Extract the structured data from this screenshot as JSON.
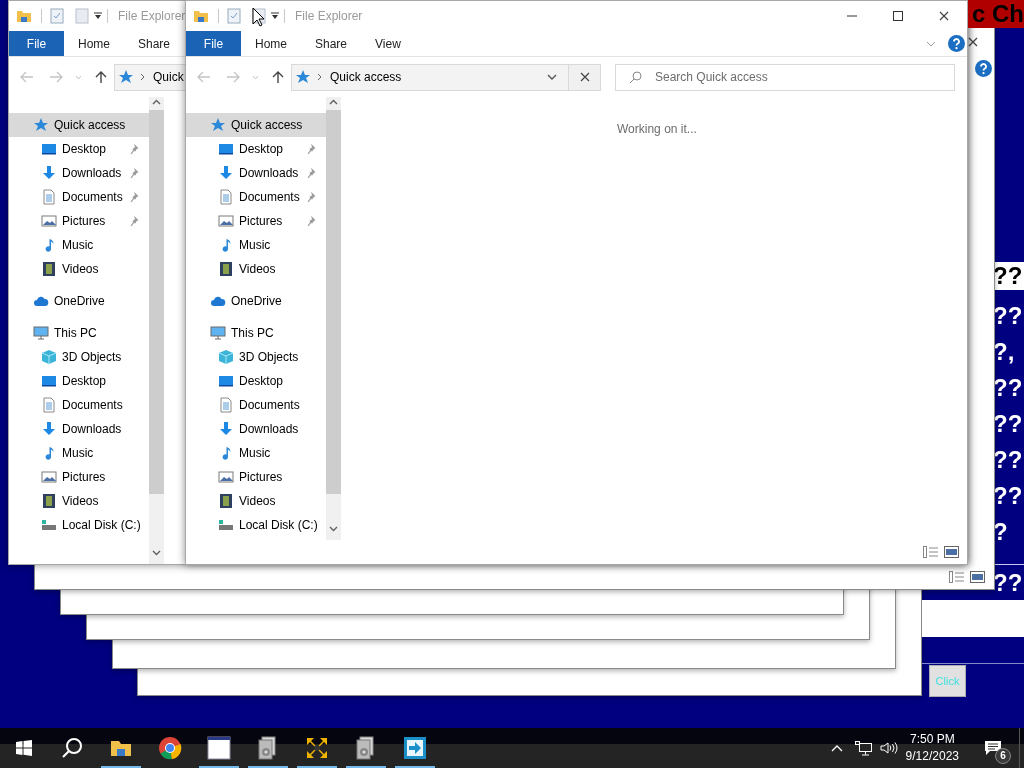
{
  "desktop_app": {
    "banner": "c Ch",
    "lines": [
      {
        "text": "??",
        "kind": "boxed"
      },
      {
        "text": "??",
        "kind": "plain"
      },
      {
        "text": "?,",
        "kind": "plain"
      },
      {
        "text": "??",
        "kind": "plain"
      },
      {
        "text": "??",
        "kind": "plain"
      },
      {
        "text": "??",
        "kind": "plain"
      },
      {
        "text": "??",
        "kind": "plain"
      },
      {
        "text": "?",
        "kind": "plain"
      },
      {
        "text": "??",
        "kind": "split"
      }
    ],
    "click_button": "Click"
  },
  "back_window": {
    "title": "File Explorer",
    "ribbon_tabs": [
      {
        "label": "File",
        "kind": "file"
      },
      {
        "label": "Home",
        "kind": "tab"
      },
      {
        "label": "Share",
        "kind": "tab"
      }
    ],
    "address": "Quick",
    "nav": [
      {
        "label": "Quick access",
        "kind": "star",
        "pinned": false,
        "selected": true,
        "children": [
          {
            "label": "Desktop",
            "kind": "desktop",
            "pinned": true,
            "selected": false
          },
          {
            "label": "Downloads",
            "kind": "downloads",
            "pinned": true,
            "selected": false
          },
          {
            "label": "Documents",
            "kind": "documents",
            "pinned": true,
            "selected": false
          },
          {
            "label": "Pictures",
            "kind": "pictures",
            "pinned": true,
            "selected": false
          },
          {
            "label": "Music",
            "kind": "music",
            "pinned": false,
            "selected": false
          },
          {
            "label": "Videos",
            "kind": "videos",
            "pinned": false,
            "selected": false
          }
        ]
      },
      {
        "label": "OneDrive",
        "kind": "cloud",
        "pinned": false,
        "selected": false
      },
      {
        "label": "This PC",
        "kind": "pc",
        "pinned": false,
        "selected": false,
        "children": [
          {
            "label": "3D Objects",
            "kind": "cube",
            "pinned": false,
            "selected": false
          },
          {
            "label": "Desktop",
            "kind": "desktop",
            "pinned": false,
            "selected": false
          },
          {
            "label": "Documents",
            "kind": "documents",
            "pinned": false,
            "selected": false
          },
          {
            "label": "Downloads",
            "kind": "downloads",
            "pinned": false,
            "selected": false
          },
          {
            "label": "Music",
            "kind": "music",
            "pinned": false,
            "selected": false
          },
          {
            "label": "Pictures",
            "kind": "pictures",
            "pinned": false,
            "selected": false
          },
          {
            "label": "Videos",
            "kind": "videos",
            "pinned": false,
            "selected": false
          },
          {
            "label": "Local Disk (C:)",
            "kind": "disk",
            "pinned": false,
            "selected": false
          }
        ]
      }
    ]
  },
  "front_window": {
    "title": "File Explorer",
    "ribbon_tabs": [
      {
        "label": "File",
        "kind": "file"
      },
      {
        "label": "Home",
        "kind": "tab"
      },
      {
        "label": "Share",
        "kind": "tab"
      },
      {
        "label": "View",
        "kind": "tab"
      }
    ],
    "address": "Quick access",
    "search": {
      "placeholder": "Search Quick access"
    },
    "status_text": "Working on it...",
    "nav": [
      {
        "label": "Quick access",
        "kind": "star",
        "pinned": false,
        "selected": true,
        "children": [
          {
            "label": "Desktop",
            "kind": "desktop",
            "pinned": true,
            "selected": false
          },
          {
            "label": "Downloads",
            "kind": "downloads",
            "pinned": true,
            "selected": false
          },
          {
            "label": "Documents",
            "kind": "documents",
            "pinned": true,
            "selected": false
          },
          {
            "label": "Pictures",
            "kind": "pictures",
            "pinned": true,
            "selected": false
          },
          {
            "label": "Music",
            "kind": "music",
            "pinned": false,
            "selected": false
          },
          {
            "label": "Videos",
            "kind": "videos",
            "pinned": false,
            "selected": false
          }
        ]
      },
      {
        "label": "OneDrive",
        "kind": "cloud",
        "pinned": false,
        "selected": false
      },
      {
        "label": "This PC",
        "kind": "pc",
        "pinned": false,
        "selected": false,
        "children": [
          {
            "label": "3D Objects",
            "kind": "cube",
            "pinned": false,
            "selected": false
          },
          {
            "label": "Desktop",
            "kind": "desktop",
            "pinned": false,
            "selected": false
          },
          {
            "label": "Documents",
            "kind": "documents",
            "pinned": false,
            "selected": false
          },
          {
            "label": "Downloads",
            "kind": "downloads",
            "pinned": false,
            "selected": false
          },
          {
            "label": "Music",
            "kind": "music",
            "pinned": false,
            "selected": false
          },
          {
            "label": "Pictures",
            "kind": "pictures",
            "pinned": false,
            "selected": false
          },
          {
            "label": "Videos",
            "kind": "videos",
            "pinned": false,
            "selected": false
          },
          {
            "label": "Local Disk (C:)",
            "kind": "disk",
            "pinned": false,
            "selected": false
          }
        ]
      }
    ]
  },
  "taskbar": {
    "apps": [
      {
        "kind": "folder",
        "running": true
      },
      {
        "kind": "browser",
        "running": false
      },
      {
        "kind": "window",
        "running": true
      },
      {
        "kind": "utility",
        "running": true
      },
      {
        "kind": "arrows",
        "running": true
      },
      {
        "kind": "utility",
        "running": true
      },
      {
        "kind": "remote",
        "running": true
      }
    ],
    "tray": {
      "time": "7:50 PM",
      "date": "9/12/2023",
      "notifications": "6"
    }
  }
}
